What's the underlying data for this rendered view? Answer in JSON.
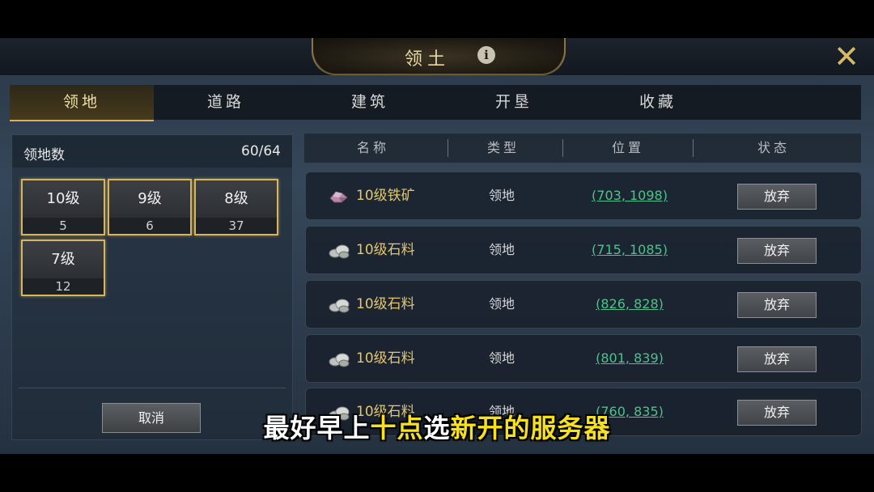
{
  "header": {
    "title": "领土",
    "info_icon": "info-icon",
    "close_icon": "close-icon"
  },
  "tabs": [
    {
      "label": "领地",
      "active": true
    },
    {
      "label": "道路",
      "active": false
    },
    {
      "label": "建筑",
      "active": false
    },
    {
      "label": "开垦",
      "active": false
    },
    {
      "label": "收藏",
      "active": false
    }
  ],
  "summary": {
    "label": "领地数",
    "value": "60/64",
    "levels": [
      {
        "level": "10级",
        "count": "5"
      },
      {
        "level": "9级",
        "count": "6"
      },
      {
        "level": "8级",
        "count": "37"
      },
      {
        "level": "7级",
        "count": "12"
      }
    ],
    "cancel_label": "取消"
  },
  "table": {
    "columns": [
      "名称",
      "类型",
      "位置",
      "状态"
    ],
    "rows": [
      {
        "icon": "iron-ore-icon",
        "name": "10级铁矿",
        "type": "领地",
        "position": "(703, 1098)",
        "action": "放弃"
      },
      {
        "icon": "stone-icon",
        "name": "10级石料",
        "type": "领地",
        "position": "(715, 1085)",
        "action": "放弃"
      },
      {
        "icon": "stone-icon",
        "name": "10级石料",
        "type": "领地",
        "position": "(826, 828)",
        "action": "放弃"
      },
      {
        "icon": "stone-icon",
        "name": "10级石料",
        "type": "领地",
        "position": "(801, 839)",
        "action": "放弃"
      },
      {
        "icon": "stone-icon",
        "name": "10级石料",
        "type": "领地",
        "position": "(760, 835)",
        "action": "放弃"
      }
    ]
  },
  "subtitle": {
    "part1": "最好早上",
    "part2": "十点",
    "part3": "选",
    "part4": "新开的服务器"
  },
  "colors": {
    "accent_gold": "#d8b45a",
    "resource_name": "#e3c66e",
    "position_link": "#4fc18a",
    "subtitle_highlight": "#f7e11e"
  }
}
